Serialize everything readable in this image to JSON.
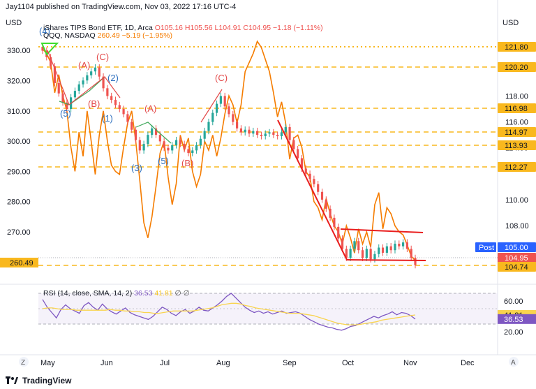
{
  "header": {
    "published_line": "Jay1104 published on TradingView.com, Nov 03, 2022 17:16 UTC-4"
  },
  "legend": {
    "main_title": "iShares TIPS Bond ETF, 1D, Arca",
    "main_ohlc": "O105.16 H105.56 L104.91 C104.95 −1.18 (−1.11%)",
    "qqq_title": "QQQ, NASDAQ",
    "qqq_values": "260.49 −5.19 (−1.95%)",
    "rsi_title": "RSI (14, close, SMA, 14, 2)",
    "rsi_value": "36.53",
    "rsi_sma_value": "41.81",
    "rsi_extra": "∅ ∅"
  },
  "footer": {
    "brand": "TradingView"
  },
  "colors": {
    "up": "#26a69a",
    "down": "#ef5350",
    "qqq": "#f57c00",
    "hline": "#f9b81e",
    "trend": "#e91e1e",
    "rsi": "#7e57c2",
    "rsi_sma": "#f9d44e",
    "wave_green": "#3fa85a",
    "wave_blue": "#2c6ebd",
    "wave_red": "#e34949"
  },
  "chart_data": {
    "type": "candlestick",
    "x_ticks": [
      "May",
      "Jun",
      "Jul",
      "Aug",
      "Sep",
      "Oct",
      "Nov",
      "Dec"
    ],
    "y_left_label": "USD",
    "y_right_label": "USD",
    "y_left_ticks": [
      330.0,
      320.0,
      310.0,
      300.0,
      290.0,
      280.0,
      270.0
    ],
    "y_right_ticks": [
      118.0,
      116.0,
      114.0,
      110.0,
      108.0
    ],
    "horizontal_levels": [
      121.8,
      120.2,
      116.98,
      114.97,
      113.93,
      112.27,
      104.74
    ],
    "price_labels": [
      {
        "text": "121.80",
        "style": "level"
      },
      {
        "text": "120.20",
        "style": "level"
      },
      {
        "text": "116.98",
        "style": "level"
      },
      {
        "text": "114.97",
        "style": "level"
      },
      {
        "text": "113.93",
        "style": "level"
      },
      {
        "text": "112.27",
        "style": "level"
      },
      {
        "text": "Post",
        "style": "post"
      },
      {
        "text": "105.00",
        "style": "post"
      },
      {
        "text": "104.95",
        "style": "last"
      },
      {
        "text": "104.74",
        "style": "level"
      }
    ],
    "qqq_last_label": "260.49",
    "tips_closes": [
      121.5,
      121.0,
      120.3,
      119.0,
      118.2,
      117.5,
      117.0,
      117.9,
      118.4,
      118.9,
      119.2,
      119.6,
      119.9,
      120.2,
      119.5,
      118.6,
      118.0,
      117.7,
      117.3,
      117.0,
      116.6,
      116.0,
      115.4,
      114.6,
      113.8,
      114.3,
      115.0,
      115.5,
      115.0,
      114.5,
      114.0,
      113.8,
      114.2,
      114.6,
      114.3,
      113.9,
      113.6,
      113.8,
      114.2,
      114.7,
      115.3,
      116.0,
      116.7,
      117.4,
      118.0,
      117.2,
      116.6,
      116.0,
      115.5,
      115.2,
      115.4,
      115.1,
      115.3,
      115.0,
      114.9,
      115.1,
      115.2,
      115.0,
      114.9,
      115.2,
      115.6,
      114.6,
      113.9,
      113.2,
      112.4,
      112.0,
      111.6,
      111.2,
      110.6,
      110.0,
      109.3,
      108.6,
      107.9,
      107.0,
      106.2,
      105.5,
      106.2,
      106.8,
      106.1,
      105.5,
      106.2,
      105.4,
      105.8,
      106.3,
      105.9,
      106.4,
      106.1,
      106.6,
      106.4,
      106.7,
      106.2,
      105.5,
      104.95
    ],
    "qqq_closes": [
      330.5,
      329.0,
      326.0,
      316.0,
      322.0,
      315.0,
      310.0,
      298.0,
      290.0,
      303.0,
      295.0,
      310.0,
      300.0,
      289.0,
      302.0,
      310.0,
      300.0,
      292.0,
      290.0,
      289.0,
      298.0,
      306.0,
      310.0,
      300.0,
      287.0,
      273.0,
      268.0,
      275.0,
      285.0,
      296.0,
      300.0,
      288.0,
      279.0,
      286.0,
      302.0,
      297.0,
      301.0,
      290.0,
      285.0,
      289.0,
      300.0,
      297.0,
      302.0,
      295.0,
      301.0,
      309.0,
      315.0,
      312.0,
      306.0,
      312.0,
      323.0,
      326.0,
      329.0,
      333.0,
      331.0,
      327.0,
      323.0,
      316.0,
      308.0,
      313.0,
      306.0,
      294.0,
      301.0,
      302.0,
      298.0,
      290.0,
      288.0,
      280.0,
      278.0,
      274.0,
      281.0,
      276.0,
      272.0,
      270.0,
      266.0,
      272.0,
      268.0,
      263.0,
      271.0,
      266.0,
      270.0,
      265.0,
      279.0,
      283.0,
      271.0,
      278.0,
      276.0,
      272.0,
      270.0,
      269.0,
      265.68,
      262.0,
      260.49
    ],
    "rsi_ticks": [
      60.0,
      20.0
    ],
    "rsi_last": 36.53,
    "rsi_sma_last": 41.81,
    "rsi": [
      62,
      52,
      45,
      38,
      49,
      55,
      50,
      47,
      44,
      54,
      58,
      52,
      48,
      56,
      50,
      46,
      43,
      47,
      51,
      45,
      42,
      40,
      38,
      36,
      40,
      46,
      52,
      49,
      44,
      41,
      46,
      49,
      44,
      47,
      52,
      48,
      47,
      51,
      55,
      60,
      66,
      70,
      64,
      58,
      52,
      48,
      45,
      47,
      44,
      46,
      43,
      45,
      47,
      44,
      45,
      46,
      44,
      40,
      36,
      33,
      30,
      28,
      26,
      25,
      23,
      22,
      24,
      27,
      28,
      31,
      34,
      37,
      40,
      38,
      41,
      43,
      46,
      42,
      45,
      44,
      41,
      36.53
    ],
    "rsi_sma": [
      50,
      51,
      51,
      50,
      49,
      49,
      49,
      48,
      48,
      48,
      48,
      48,
      48,
      48,
      49,
      48,
      48,
      47,
      47,
      46,
      46,
      45,
      45,
      44,
      44,
      45,
      46,
      47,
      47,
      47,
      47,
      47,
      48,
      49,
      50,
      51,
      53,
      55,
      56,
      57,
      57,
      56,
      54,
      53,
      51,
      50,
      49,
      48,
      47,
      46,
      45,
      44,
      44,
      44,
      43,
      42,
      41,
      39,
      37,
      35,
      33,
      31,
      30,
      29,
      29,
      29,
      30,
      31,
      32,
      33,
      35,
      36,
      37,
      38,
      39,
      40,
      41,
      41.81
    ],
    "wave_labels_red": [
      "(A)",
      "(C)",
      "(B)",
      "(A)",
      "(B)",
      "(C)"
    ],
    "wave_labels_blue": [
      "(4)",
      "(2)",
      "(5)",
      "(1)",
      "(3)",
      "(5)"
    ]
  }
}
